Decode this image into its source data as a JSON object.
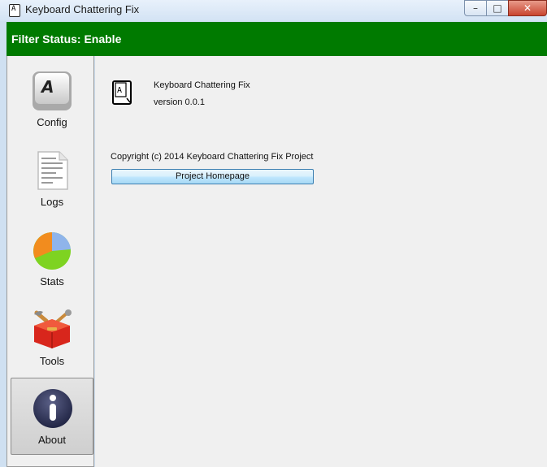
{
  "window": {
    "title": "Keyboard Chattering Fix",
    "controls": {
      "minimize": "–",
      "maximize": "□",
      "close": "✕"
    }
  },
  "status": {
    "text": "Filter Status: Enable",
    "color": "#007a00"
  },
  "sidebar": {
    "items": [
      {
        "label": "Config",
        "icon": "keyboard-key-icon",
        "active": false
      },
      {
        "label": "Logs",
        "icon": "document-icon",
        "active": false
      },
      {
        "label": "Stats",
        "icon": "pie-chart-icon",
        "active": false
      },
      {
        "label": "Tools",
        "icon": "toolbox-icon",
        "active": false
      },
      {
        "label": "About",
        "icon": "info-icon",
        "active": true
      }
    ]
  },
  "about": {
    "app_name": "Keyboard Chattering Fix",
    "version": "version 0.0.1",
    "copyright": "Copyright (c) 2014 Keyboard Chattering Fix Project",
    "homepage_button": "Project Homepage"
  }
}
